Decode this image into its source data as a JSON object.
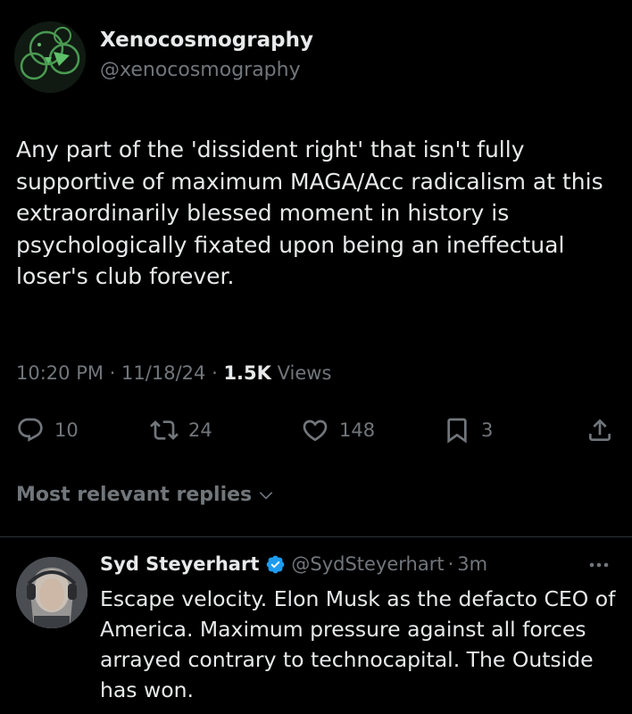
{
  "author": {
    "display_name": "Xenocosmography",
    "handle": "@xenocosmography"
  },
  "tweet": {
    "text": "Any part of the 'dissident right' that isn't fully supportive of maximum MAGA/Acc radicalism at this extraordinarily blessed moment in history is psychologically fixated upon being an ineffectual loser's club forever.",
    "time": "10:20 PM",
    "date": "11/18/24",
    "views_count": "1.5K",
    "views_label": "Views",
    "separator": "·"
  },
  "actions": {
    "replies": "10",
    "reposts": "24",
    "likes": "148",
    "bookmarks": "3"
  },
  "replies_filter": {
    "label": "Most relevant replies"
  },
  "reply": {
    "display_name": "Syd Steyerhart",
    "handle": "@SydSteyerhart",
    "separator": "·",
    "time": "3m",
    "text": "Escape velocity. Elon Musk as the defacto CEO of America. Maximum pressure against all forces arrayed contrary to technocapital. The Outside has won."
  },
  "icons": {
    "reply": "reply-icon",
    "repost": "repost-icon",
    "like": "heart-icon",
    "bookmark": "bookmark-icon",
    "share": "share-icon",
    "verified": "verified-badge-icon",
    "more": "more-icon",
    "chevron": "chevron-down-icon"
  },
  "colors": {
    "background": "#000000",
    "text_primary": "#e7e9ea",
    "text_secondary": "#71767b",
    "verified": "#1d9bf0",
    "divider": "#2f3336"
  }
}
